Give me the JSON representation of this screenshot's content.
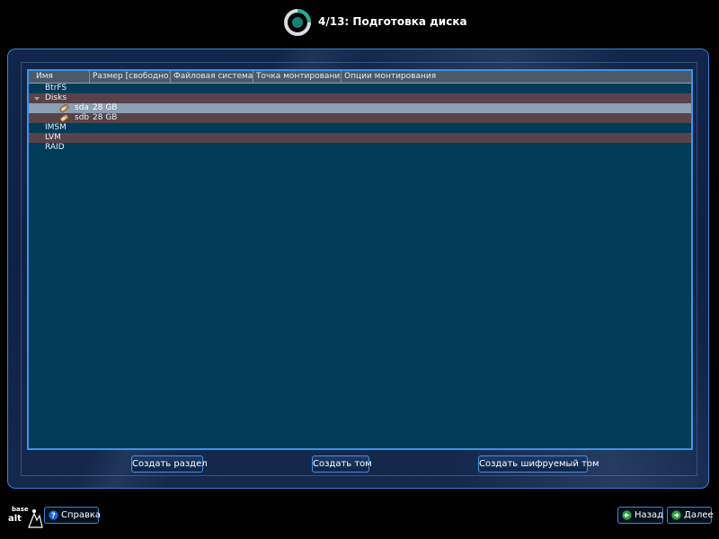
{
  "header": {
    "step_title": "4/13: Подготовка диска"
  },
  "tree": {
    "columns": [
      "Имя",
      "Размер [свободно]",
      "Файловая система",
      "Точка монтирования",
      "Опции монтирования"
    ],
    "rows": [
      {
        "name": "BtrFS",
        "size": ""
      },
      {
        "name": "Disks",
        "size": ""
      },
      {
        "name": "sda",
        "size": "28 GB"
      },
      {
        "name": "sdb",
        "size": "28 GB"
      },
      {
        "name": "IMSM",
        "size": ""
      },
      {
        "name": "LVM",
        "size": ""
      },
      {
        "name": "RAID",
        "size": ""
      }
    ],
    "expanded": "Disks",
    "selected": "sda",
    "icons": {
      "expander": "triangle-down-icon",
      "disk": "disk-drive-icon"
    }
  },
  "actions": {
    "create_partition": "Создать раздел",
    "create_volume": "Создать том",
    "create_encrypted_volume": "Создать шифруемый том"
  },
  "footer": {
    "brand_top": "base",
    "brand_bottom": "alt",
    "help": "Справка",
    "back": "Назад",
    "next": "Далее"
  },
  "colors": {
    "accent": "#3f93e8",
    "tree_background": "#003b58",
    "selected_row": "#8c9fb4",
    "alternate_row": "#58434a",
    "help_icon": "#1e64d8",
    "nav_icon": "#2ea043"
  }
}
